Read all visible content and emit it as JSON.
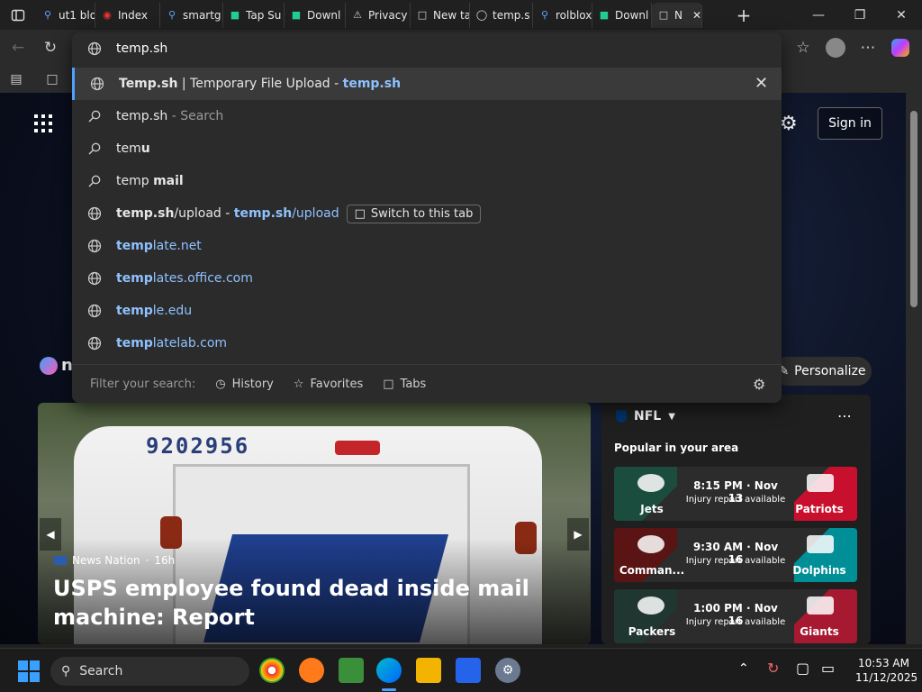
{
  "tabs": [
    {
      "label": "ut1 blo",
      "icon": "search-icon"
    },
    {
      "label": "Index",
      "icon": "reddot-icon"
    },
    {
      "label": "smartg",
      "icon": "search-icon"
    },
    {
      "label": "Tap Su",
      "icon": "app-icon"
    },
    {
      "label": "Downl",
      "icon": "app-icon"
    },
    {
      "label": "Privacy erro",
      "icon": "warning-icon"
    },
    {
      "label": "New ta",
      "icon": "newtab-icon"
    },
    {
      "label": "temp.s",
      "icon": "globe-icon"
    },
    {
      "label": "rolblox",
      "icon": "search-icon"
    },
    {
      "label": "Downl",
      "icon": "app-icon"
    },
    {
      "label": "N",
      "icon": "newtab-icon"
    }
  ],
  "omnibox": {
    "value": "temp.sh",
    "suggestions": [
      {
        "type": "globe",
        "parts": [
          {
            "t": "Temp.sh",
            "c": "b"
          },
          {
            "t": " | Temporary File Upload - ",
            "c": ""
          },
          {
            "t": "temp.sh",
            "c": "url b"
          }
        ]
      },
      {
        "type": "search",
        "parts": [
          {
            "t": "temp.sh",
            "c": ""
          },
          {
            "t": " - Search",
            "c": "muted"
          }
        ]
      },
      {
        "type": "search",
        "parts": [
          {
            "t": "tem",
            "c": ""
          },
          {
            "t": "u",
            "c": "b"
          }
        ]
      },
      {
        "type": "search",
        "parts": [
          {
            "t": "temp ",
            "c": ""
          },
          {
            "t": "mail",
            "c": "b"
          }
        ]
      },
      {
        "type": "globe",
        "parts": [
          {
            "t": "temp.sh",
            "c": "b"
          },
          {
            "t": "/upload",
            "c": ""
          },
          {
            "t": " - ",
            "c": ""
          },
          {
            "t": "temp.sh",
            "c": "url b"
          },
          {
            "t": "/upload",
            "c": "url"
          }
        ],
        "switch": "Switch to this tab"
      },
      {
        "type": "globe",
        "parts": [
          {
            "t": "temp",
            "c": "url b"
          },
          {
            "t": "late.net",
            "c": "url"
          }
        ]
      },
      {
        "type": "globe",
        "parts": [
          {
            "t": "temp",
            "c": "url b"
          },
          {
            "t": "lates.office.com",
            "c": "url"
          }
        ]
      },
      {
        "type": "globe",
        "parts": [
          {
            "t": "temp",
            "c": "url b"
          },
          {
            "t": "le.edu",
            "c": "url"
          }
        ]
      },
      {
        "type": "globe",
        "parts": [
          {
            "t": "temp",
            "c": "url b"
          },
          {
            "t": "latelab.com",
            "c": "url"
          }
        ]
      }
    ],
    "filter_label": "Filter your search:",
    "filters": [
      "History",
      "Favorites",
      "Tabs"
    ]
  },
  "newtab": {
    "sign_in": "Sign in",
    "personalize": "Personalize",
    "brand_partial": "n",
    "hero": {
      "source": "News Nation",
      "age": "16h",
      "headline": "USPS employee found dead inside mail machine: Report",
      "truck_number": "9202956"
    },
    "feed": {
      "section": "NFL",
      "subtitle": "Popular in your area",
      "games": [
        {
          "time": "8:15 PM · Nov 13",
          "note": "Injury report available",
          "home": "Jets",
          "away": "Patriots",
          "lcolor": "#1b4d3e",
          "rcolor": "#c8102e"
        },
        {
          "time": "9:30 AM · Nov 16",
          "note": "Injury report available",
          "home": "Comman...",
          "away": "Dolphins",
          "lcolor": "#5a1414",
          "rcolor": "#008e97"
        },
        {
          "time": "1:00 PM · Nov 16",
          "note": "Injury report available",
          "home": "Packers",
          "away": "Giants",
          "lcolor": "#203731",
          "rcolor": "#a71930"
        }
      ]
    }
  },
  "taskbar": {
    "search_label": "Search",
    "time": "10:53 AM",
    "date": "11/12/2025"
  }
}
